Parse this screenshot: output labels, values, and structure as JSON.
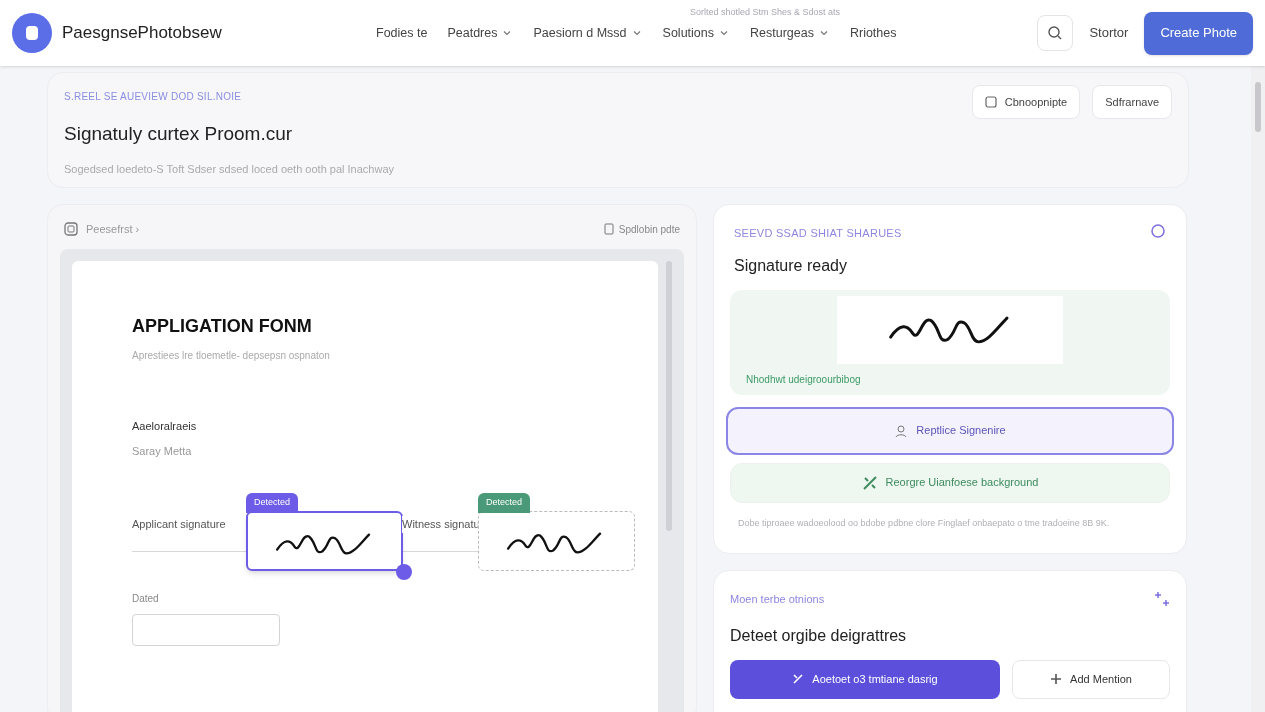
{
  "nav": {
    "logo": "PaesgnsePhotobsew",
    "note": "Sorlted shotled Stm Shes & Sdost ats",
    "items": [
      {
        "label": "Fodies te",
        "dropdown": false
      },
      {
        "label": "Peatdres",
        "dropdown": true
      },
      {
        "label": "Paesiorn d Mssd",
        "dropdown": true
      },
      {
        "label": "Solutions",
        "dropdown": true
      },
      {
        "label": "Resturgeas",
        "dropdown": true
      },
      {
        "label": "Rriothes",
        "dropdown": false
      }
    ],
    "signin": "Stortor",
    "cta": "Create Phote"
  },
  "header": {
    "eyebrow": "S.REEL SE AUEVIEW DOD SIL.NOIE",
    "title": "Signatuly curtex Proom.cur",
    "subtitle": "Sogedsed loedeto-S Toft Sdser sdsed loced oeth ooth pal Inachway",
    "buttons": [
      {
        "label": "Cbnoopnipte",
        "kind": "icon"
      },
      {
        "label": "Sdfrarnave",
        "kind": "plain"
      }
    ]
  },
  "viewer": {
    "title": "Peesefrst ›",
    "action": "Spdlobin pdte",
    "document": {
      "title": "APPLIGATION FONM",
      "subtitle": "Aprestiees lre tloemetle- depsepsn ospnaton",
      "field_label": "Aaeloralraeis",
      "field_value": "Saray Metta",
      "signatures": [
        {
          "label": "Applicant signature",
          "badge": "Detected",
          "color": "#6d5ce8",
          "selected": true
        },
        {
          "label": "Witness signatu",
          "badge": "Detected",
          "color": "#4a9a7a",
          "selected": false
        }
      ],
      "date_label": "Dated"
    }
  },
  "result": {
    "eyebrow": "SEEVD SSAD SHIAT SHARUES",
    "title": "Signature ready",
    "status": "Nhodhwt udeigroourbibog",
    "actions": [
      {
        "label": "Reptlice Signenire",
        "kind": "outline",
        "selected": true
      },
      {
        "label": "Reorgre Uianfoese background",
        "kind": "green",
        "selected": false
      }
    ],
    "note": "Dobe tiproaee wadoeolood oo bdobe pdbne clore Finglaef onbaepato o tme tradoeine 8B 9K."
  },
  "detect": {
    "eyebrow": "Moen terbe otnions",
    "title": "Deteet orgibe deigrattres",
    "primary": "Aoetoet o3 tmtiane dasrig",
    "secondary": "Add Mention"
  }
}
